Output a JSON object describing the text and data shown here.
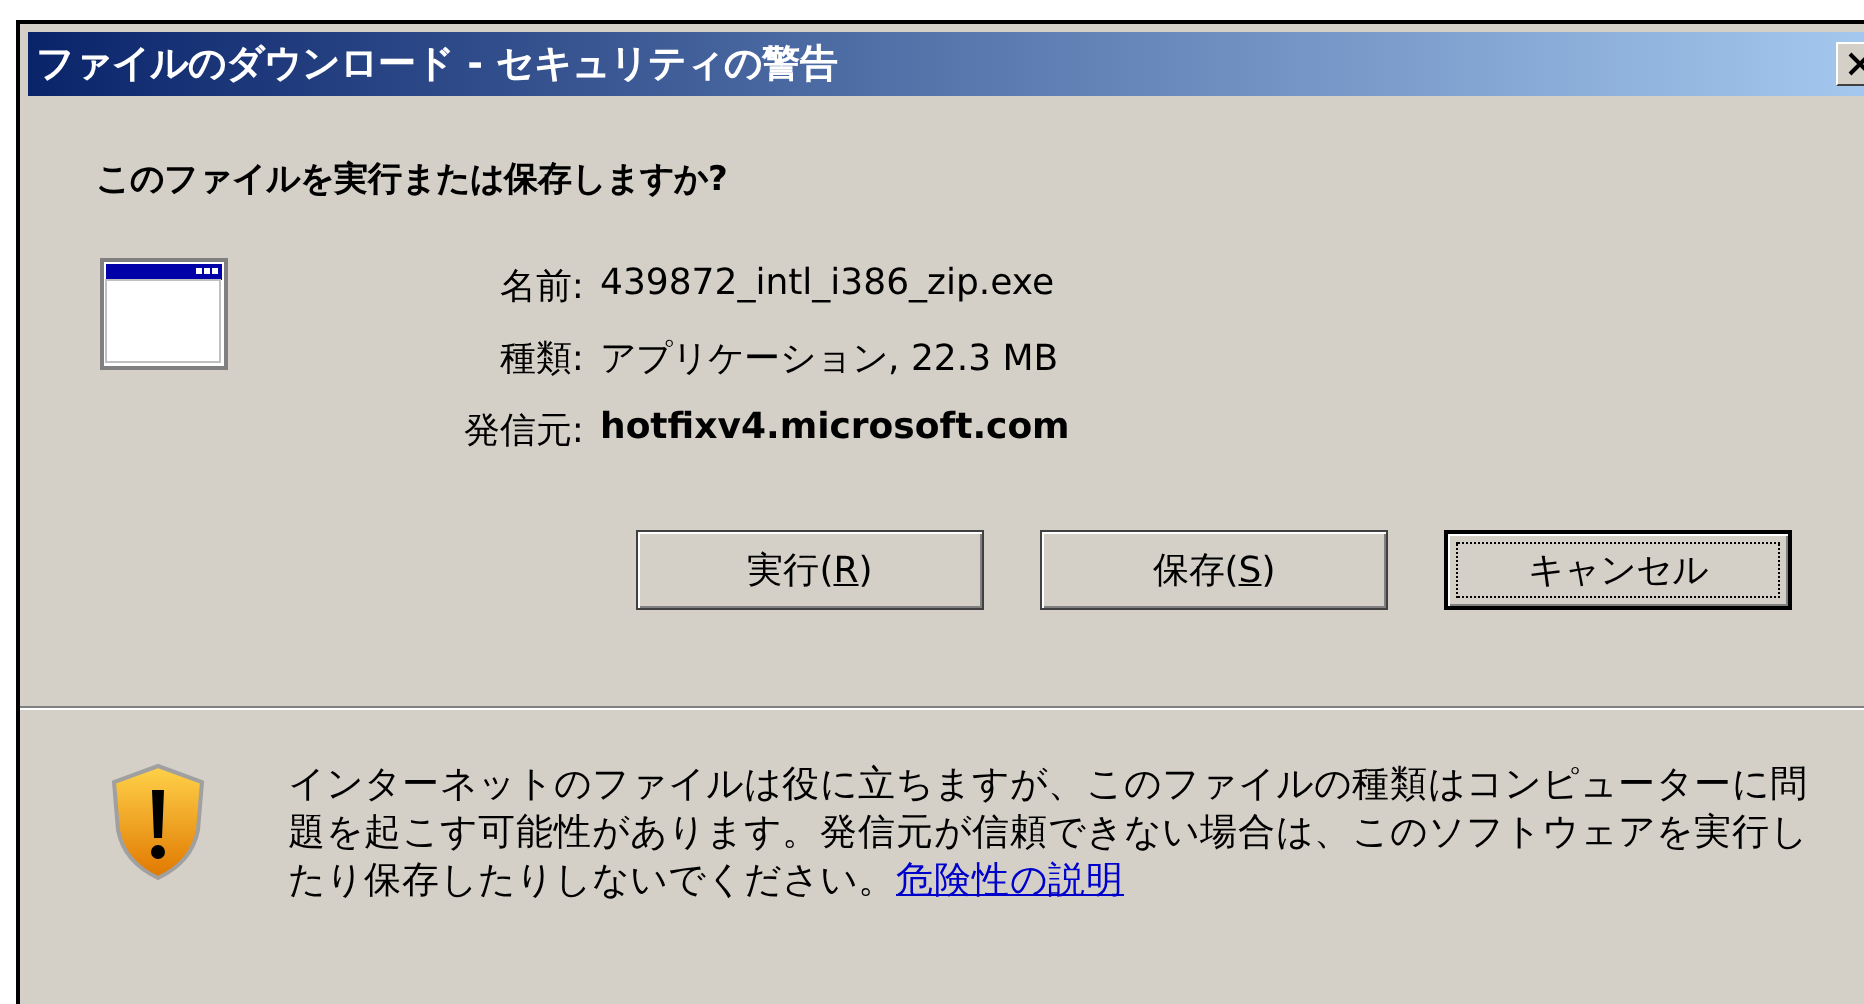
{
  "window": {
    "title": "ファイルのダウンロード - セキュリティの警告"
  },
  "question": "このファイルを実行または保存しますか?",
  "details": [
    {
      "label": "名前:",
      "value": "439872_intl_i386_zip.exe",
      "bold": false
    },
    {
      "label": "種類:",
      "value": "アプリケーション, 22.3 MB",
      "bold": false
    },
    {
      "label": "発信元:",
      "value": "hotfixv4.microsoft.com",
      "bold": true
    }
  ],
  "buttons": [
    {
      "label_parts": [
        "実行(",
        "R",
        ")"
      ],
      "focused": false
    },
    {
      "label_parts": [
        "保存(",
        "S",
        ")"
      ],
      "focused": false
    },
    {
      "label_parts": [
        "キャンセル"
      ],
      "focused": true
    }
  ],
  "warning": {
    "text": "インターネットのファイルは役に立ちますが、このファイルの種類はコンピューターに問題を起こす可能性があります。発信元が信頼できない場合は、このソフトウェアを実行したり保存したりしないでください。",
    "link": "危険性の説明"
  }
}
